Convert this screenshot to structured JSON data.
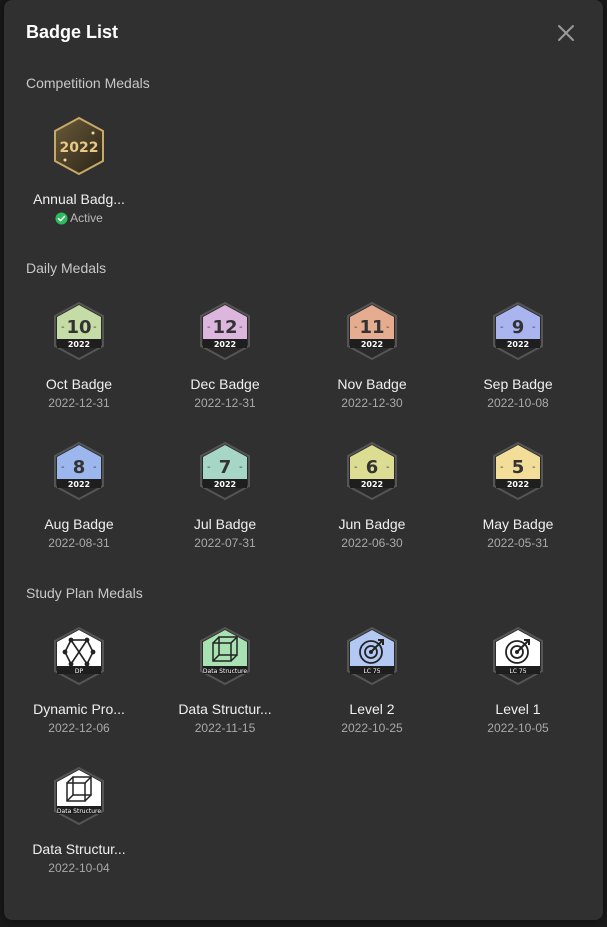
{
  "dialog": {
    "title": "Badge List"
  },
  "sections": {
    "competition": "Competition Medals",
    "daily": "Daily Medals",
    "study": "Study Plan Medals"
  },
  "competition_badges": [
    {
      "name": "Annual Badg...",
      "status": "Active",
      "icon": "2022-annual-medal-icon"
    }
  ],
  "daily_badges": [
    {
      "name": "Oct Badge",
      "date": "2022-12-31",
      "number": "10",
      "year": "2022",
      "color": "#c6dca6"
    },
    {
      "name": "Dec Badge",
      "date": "2022-12-31",
      "number": "12",
      "year": "2022",
      "color": "#dcb6dc"
    },
    {
      "name": "Nov Badge",
      "date": "2022-12-30",
      "number": "11",
      "year": "2022",
      "color": "#e6ac90"
    },
    {
      "name": "Sep Badge",
      "date": "2022-10-08",
      "number": "9",
      "year": "2022",
      "color": "#aab4ee"
    },
    {
      "name": "Aug Badge",
      "date": "2022-08-31",
      "number": "8",
      "year": "2022",
      "color": "#9cb6ee"
    },
    {
      "name": "Jul Badge",
      "date": "2022-07-31",
      "number": "7",
      "year": "2022",
      "color": "#a6d6c6"
    },
    {
      "name": "Jun Badge",
      "date": "2022-06-30",
      "number": "6",
      "year": "2022",
      "color": "#dcdc92"
    },
    {
      "name": "May Badge",
      "date": "2022-05-31",
      "number": "5",
      "year": "2022",
      "color": "#f2de98"
    }
  ],
  "study_badges": [
    {
      "name": "Dynamic Pro...",
      "date": "2022-12-06",
      "label": "DP",
      "icon": "graph-nodes-icon",
      "color": "#ffffff"
    },
    {
      "name": "Data Structur...",
      "date": "2022-11-15",
      "label": "Data Structure",
      "icon": "cube-icon",
      "color": "#a8e2b2"
    },
    {
      "name": "Level 2",
      "date": "2022-10-25",
      "label": "LC 75",
      "icon": "target-arrow-icon",
      "color": "#b4c8f4"
    },
    {
      "name": "Level 1",
      "date": "2022-10-05",
      "label": "LC 75",
      "icon": "target-arrow-icon",
      "color": "#ffffff"
    },
    {
      "name": "Data Structur...",
      "date": "2022-10-04",
      "label": "Data Structure",
      "icon": "cube-icon",
      "color": "#ffffff"
    }
  ]
}
